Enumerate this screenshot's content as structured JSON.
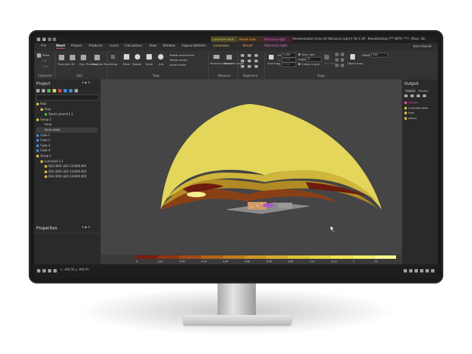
{
  "titlebar": {
    "window_title": "Hardenstadion Unna V4 Obtrusive Light A Tel 2.rdf - ReluxDesktop (*** BETA ***) - [floor: 3D...",
    "context_tabs": {
      "luminaire": "Luminaire tools",
      "result": "Result tools",
      "obtrusive": "Obtrusive light"
    },
    "buttons": [
      "—",
      "□",
      "✕"
    ]
  },
  "menu": {
    "items": [
      "File",
      "Start",
      "Project",
      "Products",
      "Insert",
      "Calculation",
      "View",
      "Window",
      "Eigene Befehle",
      "Luminaire",
      "Result",
      "Obtrusive light"
    ],
    "active": "Start",
    "user": "Karin Daxxdi"
  },
  "ribbon": {
    "clipboard": {
      "paste": "Paste",
      "cut": "Cut",
      "copy": "Copy",
      "group": "Clipboard"
    },
    "edit": {
      "floor_plan": "Floor plan",
      "threed": "3D",
      "dyn_planning": "Dyn. Planning",
      "realtime": "Realtime Rendering",
      "group": "Edit"
    },
    "tools": {
      "move": "Move",
      "rotate": "Rotate",
      "scale": "Scale",
      "aim": "Aim",
      "rotate_axis": "Rotate around axis",
      "delete_vertex": "Delete vertex",
      "insert_vertex": "Insert vertex",
      "group": "Tools"
    },
    "measure": {
      "distance": "Measure distance",
      "angle": "Measure angle",
      "group": "Measure"
    },
    "alignment": {
      "group": "Alignment"
    },
    "snap": {
      "grid_snap": "Grid snap",
      "dx_label": "dX",
      "dx_value": "1.000",
      "dy_label": "dY",
      "dy_value": "1.000",
      "dz_label": "dZ",
      "dz_value": "1.000",
      "sync_axis": "Sync. axis",
      "angle_label": "Angle",
      "angle_value": "15",
      "center_grid": "Center in grid",
      "cad_snap": "CAD snap",
      "object_snap": "Object snap",
      "offset_label": "Offset",
      "offset_value": "0.500",
      "group": "Snap"
    }
  },
  "project": {
    "title": "Project",
    "tree": [
      {
        "label": "floor",
        "depth": 0,
        "icon": "folder"
      },
      {
        "label": "Floor",
        "depth": 1,
        "icon": "folder"
      },
      {
        "label": "Sports ground 1.1",
        "depth": 2,
        "icon": "green"
      },
      {
        "label": "Group 1",
        "depth": 0,
        "icon": "folder"
      },
      {
        "label": "Unna",
        "depth": 1,
        "icon": "none"
      },
      {
        "label": "Unna roads",
        "depth": 1,
        "icon": "none"
      },
      {
        "label": "Cube 1",
        "depth": 0,
        "icon": "blue"
      },
      {
        "label": "Cube 2",
        "depth": 0,
        "icon": "blue"
      },
      {
        "label": "Cube 3",
        "depth": 0,
        "icon": "blue"
      },
      {
        "label": "Cube 4",
        "depth": 0,
        "icon": "blue"
      },
      {
        "label": "Group 1",
        "depth": 0,
        "icon": "folder"
      },
      {
        "label": "Luminaire 1.1",
        "depth": 1,
        "icon": "lum"
      },
      {
        "label": "DS2 (D92 LED) 110000.850",
        "depth": 2,
        "icon": "lum"
      },
      {
        "label": "DS2 (D92 LED) 110000.850",
        "depth": 2,
        "icon": "lum"
      },
      {
        "label": "DS2 (D92 LED) 110000.850",
        "depth": 2,
        "icon": "lum"
      }
    ]
  },
  "properties": {
    "title": "Properties"
  },
  "output": {
    "title": "Output",
    "tabs": [
      "Output",
      "Results"
    ],
    "tree": [
      "Layouts",
      "Luminaire data",
      "floor",
      "others"
    ]
  },
  "legend": {
    "labels": [
      "0",
      "0.01",
      "0.02",
      "0.03",
      "0.05",
      "0.06",
      "0.08",
      "0.09",
      "0.11",
      "0.14",
      "1",
      "20"
    ],
    "colors": [
      "#7a1c10",
      "#8e3412",
      "#a34b15",
      "#b36418",
      "#c27d1d",
      "#cd9623",
      "#d6ad2b",
      "#dcc236",
      "#e3d443",
      "#ebe352",
      "#f2ee68",
      "#f8f78c"
    ]
  },
  "statusbar": {
    "coords": "x: -400.59  y: -806.95"
  },
  "colors": {
    "accent": "#e04e9d",
    "background": "#2b2b2b",
    "viewport": "#454545"
  }
}
